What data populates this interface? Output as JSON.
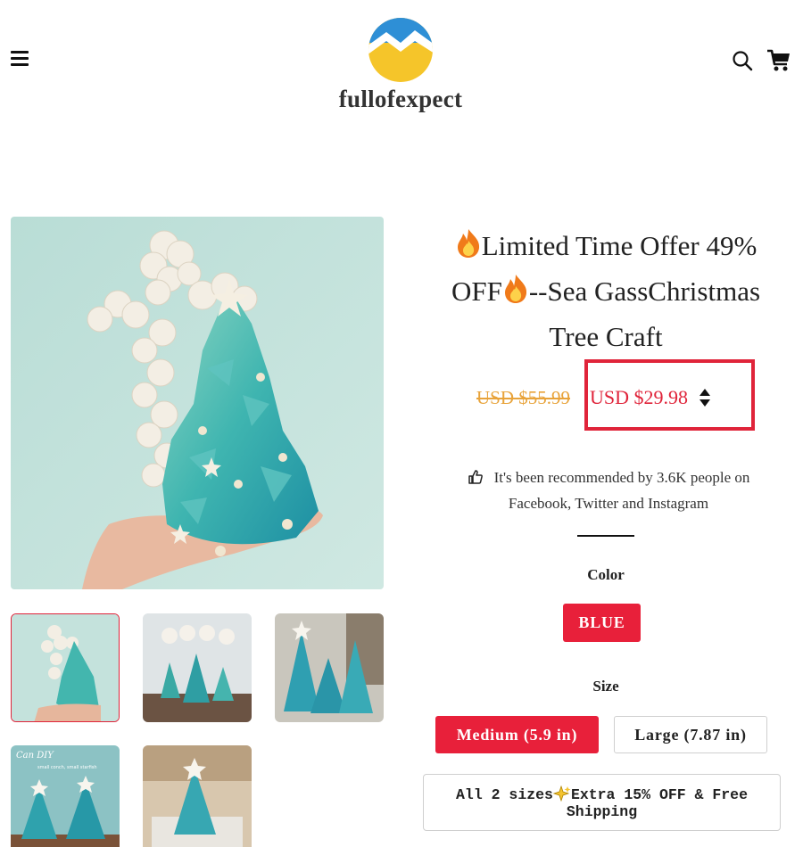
{
  "header": {
    "brand": "fullofexpect",
    "menu_icon": "hamburger-menu-icon",
    "search_icon": "search-icon",
    "cart_icon": "cart-icon"
  },
  "gallery": {
    "main_image": "sea-glass-christmas-tree-photo",
    "thumbnails": [
      {
        "name": "tree-with-shell-cross"
      },
      {
        "name": "trees-on-table"
      },
      {
        "name": "trees-in-room"
      },
      {
        "name": "trees-on-wood",
        "caption_line1": "Can DIY",
        "caption_line2": "small conch, small starfish"
      },
      {
        "name": "tree-on-box"
      }
    ]
  },
  "product": {
    "title_line1": "Limited Time Offer 49%",
    "title_line2_a": "OFF",
    "title_line2_b": "--Sea GassChristmas",
    "title_line3": "Tree Craft",
    "old_price": "USD $55.99",
    "new_price": "USD $29.98",
    "currency_toggle_icon": "sort-arrows-icon",
    "recommend_line1": "It's been recommended by 3.6K people on",
    "recommend_line2": "Facebook, Twitter and Instagram"
  },
  "options": {
    "color_label": "Color",
    "colors": [
      "BLUE"
    ],
    "size_label": "Size",
    "sizes": [
      "Medium (5.9 in)",
      "Large (7.87 in)"
    ],
    "bundle_line1_a": "All 2 sizes",
    "bundle_line1_b": "Extra 15% OFF & Free",
    "bundle_line2": "Shipping"
  },
  "colors": {
    "accent_red": "#e0243a",
    "old_price": "#e8a33a",
    "logo_blue": "#3aa0e0",
    "logo_yellow": "#f5c52a"
  }
}
